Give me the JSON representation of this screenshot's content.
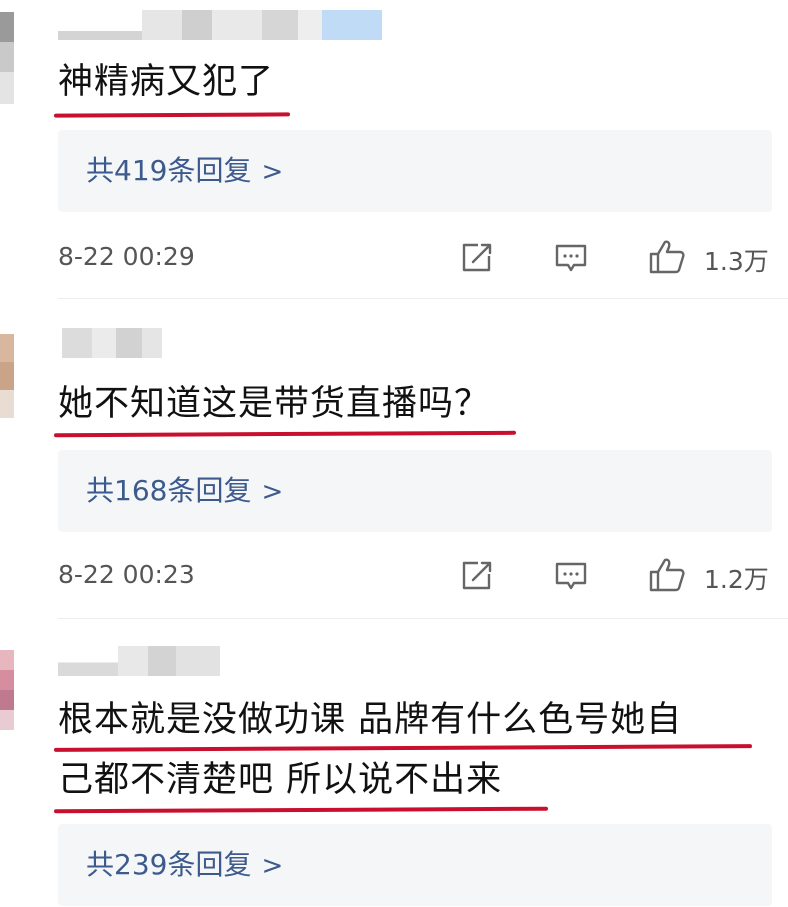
{
  "comments": [
    {
      "text_lines": [
        "神精病又犯了"
      ],
      "replies_label": "共419条回复",
      "timestamp": "8-22 00:29",
      "like_count": "1.3万"
    },
    {
      "text_lines": [
        "她不知道这是带货直播吗？"
      ],
      "replies_label": "共168条回复",
      "timestamp": "8-22 00:23",
      "like_count": "1.2万"
    },
    {
      "text_lines": [
        "根本就是没做功课 品牌有什么色号她自",
        "己都不清楚吧 所以说不出来"
      ],
      "replies_label": "共239条回复"
    }
  ],
  "icons": {
    "reply_chevron": "chevron-right-icon",
    "share": "share-edit-icon",
    "comment": "comment-icon",
    "like": "thumbs-up-icon"
  },
  "colors": {
    "underline": "#c8102e",
    "reply_link": "#3c5b8c",
    "reply_bg": "#f5f6f8",
    "meta_text": "#555555"
  }
}
